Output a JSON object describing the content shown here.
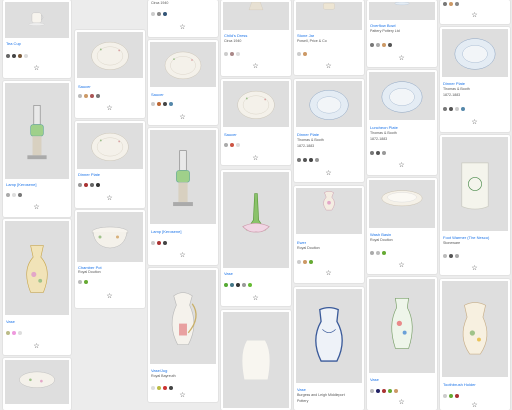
{
  "star_icon": "☆",
  "cards": [
    {
      "title": "Tea Cup",
      "sub1": "",
      "sub2": "",
      "img": "cup",
      "colors": [
        "#666",
        "#444",
        "#7a5a3a",
        "#ddd"
      ]
    },
    {
      "title": "",
      "sub1": "",
      "sub2": "",
      "img": "lamp",
      "colors": [
        "#777",
        "#ccc",
        "#555"
      ]
    },
    {
      "title": "Lamp [Kerosene]",
      "sub1": "",
      "sub2": "",
      "img": "lamp",
      "colors": [
        "#aaa",
        "#ddd",
        "#777"
      ]
    },
    {
      "title": "Vase",
      "sub1": "",
      "sub2": "",
      "img": "vase",
      "colors": [
        "#bb8",
        "#e9d",
        "#ddd"
      ]
    },
    {
      "title": "",
      "sub1": "",
      "sub2": "",
      "img": "bowl",
      "colors": []
    },
    {
      "title": "Saucer",
      "sub1": "",
      "sub2": "",
      "img": "plate",
      "colors": [
        "#bbb",
        "#c96",
        "#a55",
        "#777"
      ]
    },
    {
      "title": "Dinner Plate",
      "sub1": "",
      "sub2": "",
      "img": "plate",
      "colors": [
        "#999",
        "#a33",
        "#666",
        "#333"
      ]
    },
    {
      "title": "Chamber Pot",
      "sub1": "Royal Doulton",
      "sub2": "",
      "img": "pot",
      "colors": [
        "#bbb",
        "#6a3"
      ]
    },
    {
      "title": "",
      "sub1": "Circa 1940",
      "sub2": "",
      "img": "none",
      "colors": [
        "#ccc",
        "#888",
        "#357"
      ]
    },
    {
      "title": "Saucer",
      "sub1": "",
      "sub2": "",
      "img": "plate",
      "colors": [
        "#ccc",
        "#b63",
        "#444",
        "#58a"
      ]
    },
    {
      "title": "Lamp [Kerosene]",
      "sub1": "",
      "sub2": "",
      "img": "lamp",
      "colors": [
        "#ccc",
        "#a33",
        "#444"
      ]
    },
    {
      "title": "Vase/Jug",
      "sub1": "Royal Bayreuth",
      "sub2": "",
      "img": "jug",
      "colors": [
        "#ddd",
        "#bb4",
        "#c33",
        "#444"
      ]
    },
    {
      "title": "Child's Dress",
      "sub1": "Circa 1940",
      "sub2": "",
      "img": "dress",
      "colors": [
        "#ccc",
        "#a88",
        "#ddd"
      ]
    },
    {
      "title": "Saucer",
      "sub1": "",
      "sub2": "",
      "img": "plate",
      "colors": [
        "#aaa",
        "#c54",
        "#ddd"
      ]
    },
    {
      "title": "Vase",
      "sub1": "",
      "sub2": "",
      "img": "glassvase",
      "colors": [
        "#5a3",
        "#478",
        "#333",
        "#999",
        "#6b3"
      ]
    },
    {
      "title": "",
      "sub1": "",
      "sub2": "",
      "img": "whitevase",
      "colors": []
    },
    {
      "title": "Stone Jar",
      "sub1": "Powell, Price & Co",
      "sub2": "",
      "img": "jar",
      "colors": [
        "#ccc",
        "#c96"
      ]
    },
    {
      "title": "Dinner Plate",
      "sub1": "Thomas & Booth",
      "sub2": "1872-1883",
      "img": "blueplate",
      "colors": [
        "#777",
        "#555",
        "#444",
        "#999"
      ]
    },
    {
      "title": "Ewer",
      "sub1": "Royal Doulton",
      "sub2": "",
      "img": "ewer",
      "colors": [
        "#ccc",
        "#c96",
        "#6a3"
      ]
    },
    {
      "title": "Vase",
      "sub1": "Burgess and Leigh Middleport",
      "sub2": "Pottery",
      "img": "bluejug",
      "colors": []
    },
    {
      "title": "Overflow Bowl",
      "sub1": "Pattery Pottery Ltd",
      "sub2": "",
      "img": "bowltop",
      "colors": [
        "#777",
        "#aaa",
        "#c96",
        "#555"
      ]
    },
    {
      "title": "Luncheon Plate",
      "sub1": "Thomas & Booth",
      "sub2": "1872-1883",
      "img": "blueplate",
      "colors": [
        "#777",
        "#555",
        "#999"
      ]
    },
    {
      "title": "Wash Basin",
      "sub1": "Royal Doulton",
      "sub2": "",
      "img": "basin",
      "colors": [
        "#aaa",
        "#bbb",
        "#6a3"
      ]
    },
    {
      "title": "Vase",
      "sub1": "",
      "sub2": "",
      "img": "flowervase",
      "colors": [
        "#bbb",
        "#226",
        "#a33",
        "#6a3",
        "#c96"
      ]
    },
    {
      "title": "",
      "sub1": "",
      "sub2": "",
      "img": "none",
      "colors": [
        "#777",
        "#c96",
        "#888"
      ]
    },
    {
      "title": "Dinner Plate",
      "sub1": "Thomas & Booth",
      "sub2": "1872-1883",
      "img": "blueplate",
      "colors": [
        "#777",
        "#555",
        "#ccc",
        "#58a"
      ]
    },
    {
      "title": "Foot Warmer (The Nesco)",
      "sub1": "Stoneware",
      "sub2": "",
      "img": "warmer",
      "colors": [
        "#bbb",
        "#555",
        "#aaa"
      ]
    },
    {
      "title": "Toothbrush Holder",
      "sub1": "",
      "sub2": "",
      "img": "pitcher",
      "colors": [
        "#ccc",
        "#6a3",
        "#a33"
      ]
    }
  ]
}
